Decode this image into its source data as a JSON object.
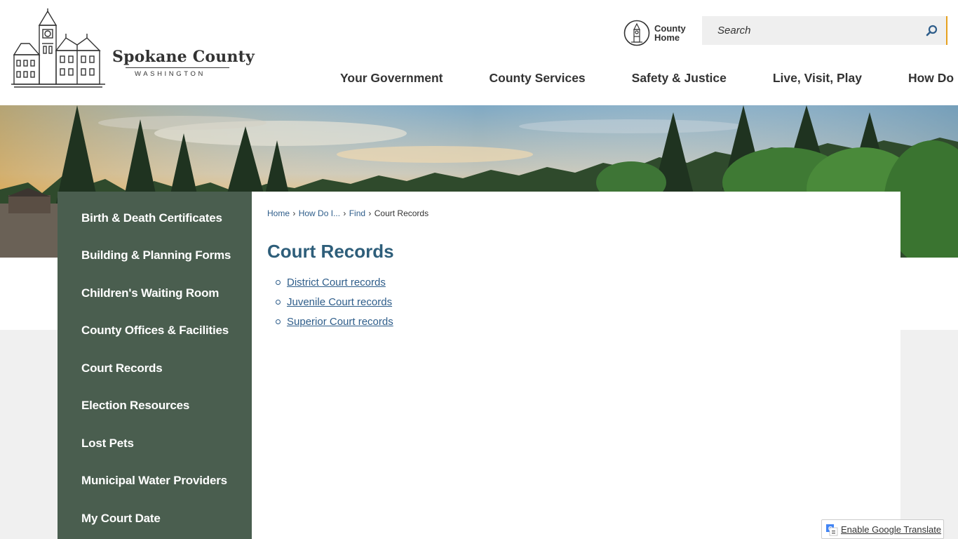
{
  "header": {
    "logo": {
      "name": "Spokane County",
      "state": "WASHINGTON"
    },
    "county_home_label": "County Home",
    "search": {
      "placeholder": "Search"
    },
    "nav": [
      {
        "label": "Your Government"
      },
      {
        "label": "County Services"
      },
      {
        "label": "Safety & Justice"
      },
      {
        "label": "Live, Visit, Play"
      },
      {
        "label": "How Do I..."
      }
    ]
  },
  "sidebar": {
    "items": [
      {
        "label": "Birth & Death Certificates"
      },
      {
        "label": "Building & Planning Forms"
      },
      {
        "label": "Children's Waiting Room"
      },
      {
        "label": "County Offices & Facilities"
      },
      {
        "label": "Court Records"
      },
      {
        "label": "Election Resources"
      },
      {
        "label": "Lost Pets"
      },
      {
        "label": "Municipal Water Providers"
      },
      {
        "label": "My Court Date"
      }
    ]
  },
  "breadcrumb": {
    "items": [
      "Home",
      "How Do I...",
      "Find"
    ],
    "current": "Court Records"
  },
  "main": {
    "title": "Court Records",
    "links": [
      {
        "label": "District Court records"
      },
      {
        "label": "Juvenile Court records"
      },
      {
        "label": "Superior Court records"
      }
    ]
  },
  "translate": {
    "label": "Enable Google Translate"
  },
  "colors": {
    "sidebar_bg": "#4a5e4f",
    "title": "#2e5e7a",
    "link": "#2e5d8a",
    "accent": "#e6a11d"
  },
  "icons": {
    "logo": "courthouse-logo-icon",
    "county_home": "courthouse-tower-icon",
    "search": "search-icon",
    "translate": "google-translate-icon"
  }
}
